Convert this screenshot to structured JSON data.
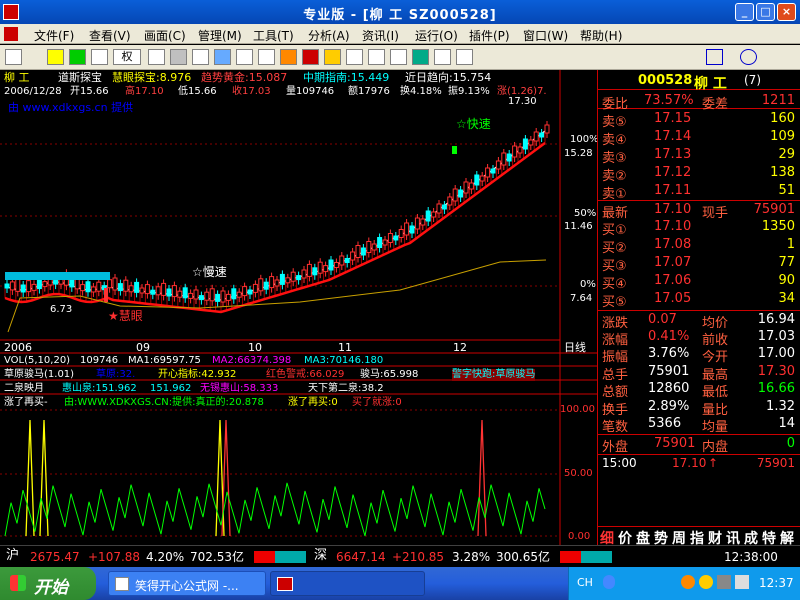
{
  "window": {
    "title": "专业版 - [柳    工  SZ000528]",
    "controls": [
      "_",
      "□",
      "×"
    ]
  },
  "menu": [
    "文件(F)",
    "查看(V)",
    "画面(C)",
    "管理(M)",
    "工具(T)",
    "分析(A)",
    "资讯(I)",
    "运行(O)",
    "插件(P)",
    "窗口(W)",
    "帮助(H)"
  ],
  "toolbar": {
    "quan_label": "权"
  },
  "chart": {
    "header_line1": {
      "name": "柳    工",
      "indicator": "道斯探宝",
      "items": [
        {
          "label": "慧眼探宝:8.976",
          "color": "#ffff00"
        },
        {
          "label": "趋势黄金:15.087",
          "color": "#ff4040"
        },
        {
          "label": "中期指南:15.449",
          "color": "#00ffff"
        },
        {
          "label": "近日趋向:15.754",
          "color": "#ffffff"
        }
      ]
    },
    "header_line2": {
      "date": "2006/12/28",
      "open": "开15.66",
      "high": "高17.10",
      "low": "低15.66",
      "close": "收17.03",
      "vol": "量109746",
      "amt": "额17976",
      "turn": "换4.18%",
      "amp": "振9.13%",
      "chg": "涨(1.26)7."
    },
    "header_line3": "由 www.xdkxgs.cn 提供",
    "price_labels": [
      "17.30",
      "15.28",
      "11.46",
      "7.64"
    ],
    "pct_labels": [
      "100%",
      "50%",
      "0%"
    ],
    "low_label": "6.73",
    "annotations": {
      "fast": "☆快速",
      "slow": "☆慢速",
      "smart": "★慧眼"
    },
    "x_labels": [
      "2006",
      "09",
      "10",
      "11",
      "12"
    ],
    "period": "日线",
    "vol_line": {
      "label": "VOL(5,10,20)",
      "v": "109746",
      "ma1": "MA1:69597.75",
      "ma2": "MA2:66374.398",
      "ma3": "MA3:70146.180"
    },
    "ind2_line": {
      "name": "草原骏马(1.01)",
      "a": "草原:32.",
      "b": "开心指标:42.932",
      "c": "红色警戒:66.029",
      "d": "骏马:65.998",
      "e": "警字快跑:草原骏马"
    },
    "ind3_line": {
      "name": "二泉映月",
      "a": "惠山泉:151.962",
      "b": "151.962",
      "c": "无锡惠山:58.333",
      "d": "天下第二泉:38.2"
    },
    "ind4_line": {
      "name": "涨了再买-",
      "a": "由:WWW.XDKXGS.CN:提供:真正的:20.878",
      "b": "涨了再买:0",
      "c": "买了就涨:0"
    },
    "ind4_scale": [
      "100.00",
      "50.00",
      "0.00"
    ]
  },
  "panel": {
    "code": "000528",
    "name": "柳  工",
    "num": "(7)",
    "weibi_label": "委比",
    "weibi": "73.57%",
    "weicha_label": "委差",
    "weicha": "1211",
    "sells": [
      {
        "label": "卖⑤",
        "price": "17.15",
        "vol": "160"
      },
      {
        "label": "卖④",
        "price": "17.14",
        "vol": "109"
      },
      {
        "label": "卖③",
        "price": "17.13",
        "vol": "29"
      },
      {
        "label": "卖②",
        "price": "17.12",
        "vol": "138"
      },
      {
        "label": "卖①",
        "price": "17.11",
        "vol": "51"
      }
    ],
    "latest_label": "最新",
    "latest": "17.10",
    "xianshou_label": "现手",
    "xianshou": "75901",
    "buys": [
      {
        "label": "买①",
        "price": "17.10",
        "vol": "1350"
      },
      {
        "label": "买②",
        "price": "17.08",
        "vol": "1"
      },
      {
        "label": "买③",
        "price": "17.07",
        "vol": "77"
      },
      {
        "label": "买④",
        "price": "17.06",
        "vol": "90"
      },
      {
        "label": "买⑤",
        "price": "17.05",
        "vol": "34"
      }
    ],
    "stats": [
      {
        "l1": "涨跌",
        "v1": "0.07",
        "l2": "均价",
        "v2": "16.94"
      },
      {
        "l1": "涨幅",
        "v1": "0.41%",
        "l2": "前收",
        "v2": "17.03"
      },
      {
        "l1": "振幅",
        "v1": "3.76%",
        "l2": "今开",
        "v2": "17.00"
      },
      {
        "l1": "总手",
        "v1": "75901",
        "l2": "最高",
        "v2": "17.30"
      },
      {
        "l1": "总额",
        "v1": "12860",
        "l2": "最低",
        "v2": "16.66"
      },
      {
        "l1": "换手",
        "v1": "2.89%",
        "l2": "量比",
        "v2": "1.32"
      },
      {
        "l1": "笔数",
        "v1": "5366",
        "l2": "均量",
        "v2": "14"
      }
    ],
    "waipan_label": "外盘",
    "waipan": "75901",
    "neipan_label": "内盘",
    "neipan": "0",
    "tick": {
      "time": "15:00",
      "price": "17.10",
      "vol": "75901"
    },
    "tabs": [
      "细",
      "价",
      "盘",
      "势",
      "周",
      "指",
      "财",
      "讯",
      "成",
      "特",
      "解"
    ]
  },
  "indexbar": {
    "sh_label": "沪",
    "sh": "2675.47",
    "sh_chg": "+107.88",
    "sh_pct": "4.20%",
    "sh_amt": "702.53亿",
    "sz_label": "深",
    "sz": "6647.14",
    "sz_chg": "+210.85",
    "sz_pct": "3.28%",
    "sz_amt": "300.65亿",
    "time": "12:38:00"
  },
  "taskbar": {
    "start": "开始",
    "task1": "笑得开心公式网 -...",
    "lang": "CH",
    "clock": "12:37"
  }
}
